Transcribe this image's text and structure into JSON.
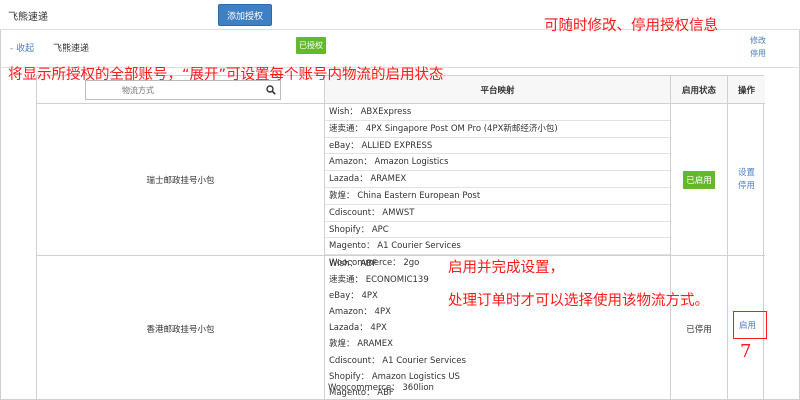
{
  "header": {
    "title": "飞熊速递",
    "add_button": "添加授权"
  },
  "account": {
    "collapse": "- 收起",
    "name": "飞熊速递",
    "badge": "已授权",
    "modify": "修改",
    "disable": "停用"
  },
  "annotations": {
    "a1": "可随时修改、停用授权信息",
    "a2": "将显示所授权的全部账号，“展开”可设置每个账号内物流的启用状态",
    "a3": "启用并完成设置，",
    "a4": "处理订单时才可以选择使用该物流方式。",
    "step": "7"
  },
  "table": {
    "search_placeholder": "物流方式",
    "col_map": "平台映射",
    "col_status": "启用状态",
    "col_op": "操作",
    "rows": [
      {
        "method": "瑞士邮政挂号小包",
        "mappings": [
          "Wish： ABXExpress",
          "速卖通： 4PX Singapore Post OM Pro (4PX新邮经济小包)",
          "eBay： ALLIED EXPRESS",
          "Amazon： Amazon Logistics",
          "Lazada： ARAMEX",
          "敦煌： China Eastern European Post",
          "Cdiscount： AMWST",
          "Shopify： APC",
          "Magento： A1 Courier Services",
          "Woocommerce： 2go"
        ],
        "status": "已启用",
        "op1": "设置",
        "op2": "停用"
      },
      {
        "method": "香港邮政挂号小包",
        "mappings": [
          "Wish： ABF",
          "速卖通： ECONOMIC139",
          "eBay： 4PX",
          "Amazon： 4PX",
          "Lazada： 4PX",
          "敦煌： ARAMEX",
          "Cdiscount： A1 Courier Services",
          "Shopify： Amazon Logistics US",
          "Magento： ABF",
          "Woocommerce： 360lion"
        ],
        "status": "已停用",
        "op1": "启用"
      }
    ]
  },
  "colors": {
    "accent": "#3f7fc4",
    "enabled_green": "#64b92b",
    "annotation_red": "#ff1a1a",
    "link": "#4a7fc1"
  }
}
